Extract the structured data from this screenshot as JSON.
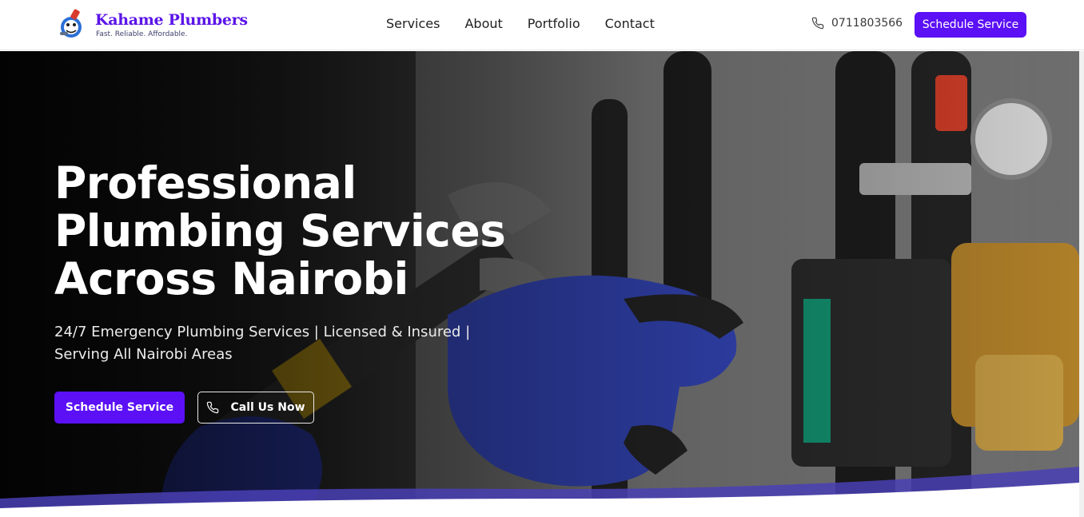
{
  "header": {
    "brand_name": "Kahame Plumbers",
    "brand_tagline": "Fast. Reliable. Affordable.",
    "nav": [
      "Services",
      "About",
      "Portfolio",
      "Contact"
    ],
    "phone": "0711803566",
    "cta_label": "Schedule Service"
  },
  "hero": {
    "title_lines": [
      "Professional",
      "Plumbing Services",
      "Across Nairobi"
    ],
    "subtitle_line1": "24/7 Emergency Plumbing Services | Licensed & Insured |",
    "subtitle_line2": "Serving All Nairobi Areas",
    "primary_button": "Schedule Service",
    "secondary_button": "Call Us Now"
  },
  "colors": {
    "accent": "#5b10f5",
    "brand_text": "#5b14e8"
  },
  "icons": {
    "logo": "plumber-mascot-icon",
    "phone": "phone-icon"
  }
}
